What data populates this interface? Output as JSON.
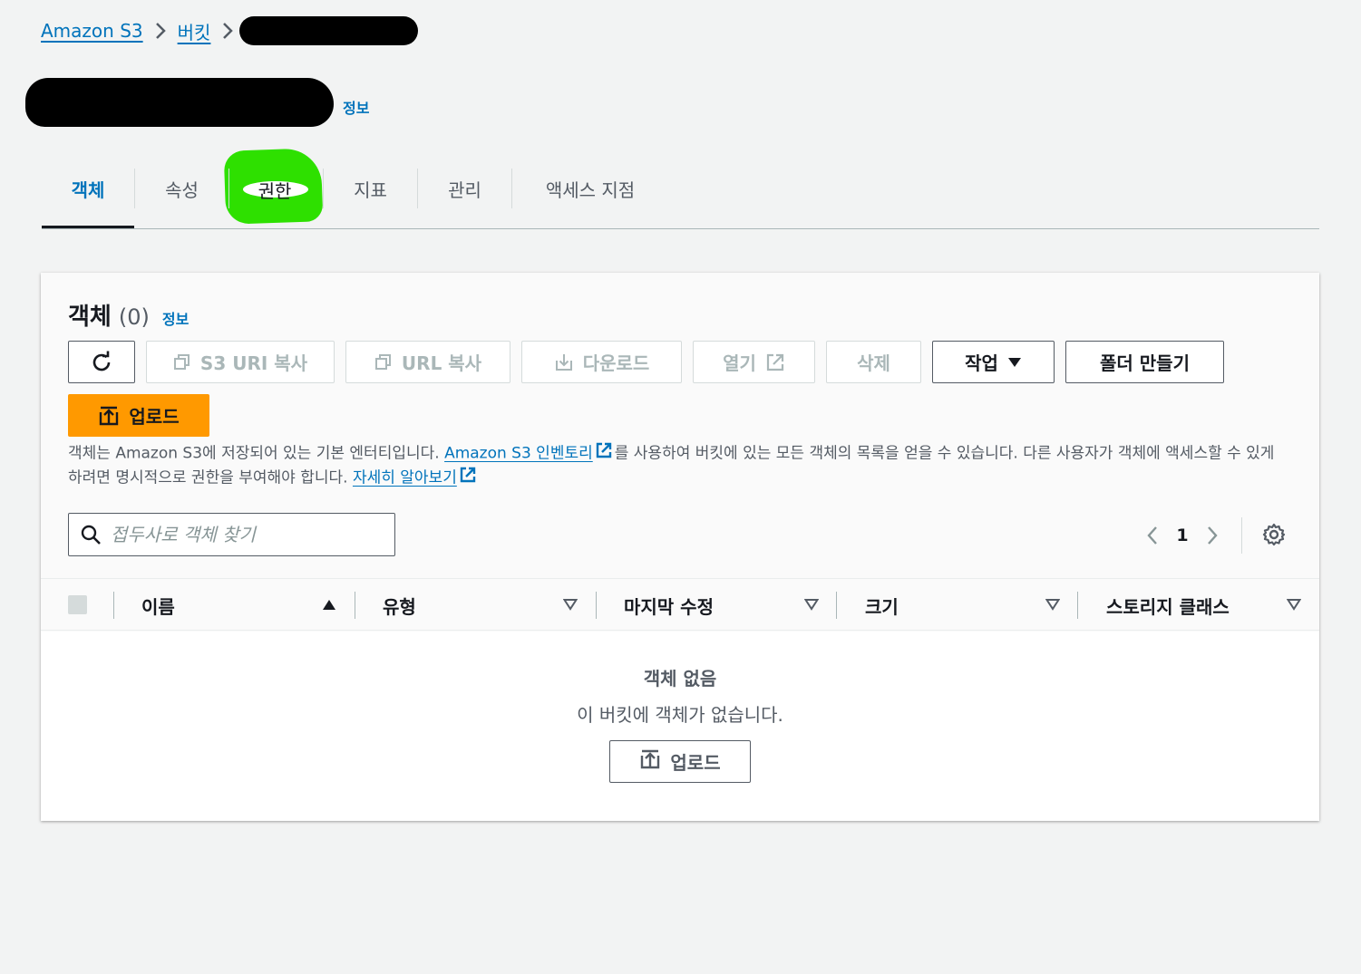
{
  "breadcrumb": {
    "items": [
      {
        "label": "Amazon S3"
      },
      {
        "label": "버킷"
      }
    ]
  },
  "header": {
    "info_label": "정보"
  },
  "tabs": [
    {
      "label": "객체",
      "active": true
    },
    {
      "label": "속성"
    },
    {
      "label": "권한"
    },
    {
      "label": "지표"
    },
    {
      "label": "관리"
    },
    {
      "label": "액세스 지점"
    }
  ],
  "objects_panel": {
    "title": "객체",
    "count": "(0)",
    "info_label": "정보",
    "buttons": {
      "refresh": "",
      "copy_s3_uri": "S3 URI 복사",
      "copy_url": "URL 복사",
      "download": "다운로드",
      "open": "열기",
      "delete": "삭제",
      "actions": "작업",
      "create_folder": "폴더 만들기",
      "upload": "업로드"
    },
    "description": {
      "part1": "객체는 Amazon S3에 저장되어 있는 기본 엔터티입니다. ",
      "link1": "Amazon S3 인벤토리",
      "part2": "를 사용하여 버킷에 있는 모든 객체의 목록을 얻을 수 있습니다. 다른 사용자가 객체에 액세스할 수 있게 하려면 명시적으로 권한을 부여해야 합니다. ",
      "link2": "자세히 알아보기"
    },
    "search": {
      "placeholder": "접두사로 객체 찾기",
      "value": ""
    },
    "pagination": {
      "current_page": "1"
    },
    "table": {
      "columns": [
        "이름",
        "유형",
        "마지막 수정",
        "크기",
        "스토리지 클래스"
      ],
      "sorted_column": "이름",
      "sort_direction": "ascending"
    },
    "empty_state": {
      "title": "객체 없음",
      "subtitle": "이 버킷에 객체가 없습니다.",
      "upload_label": "업로드"
    }
  },
  "colors": {
    "link": "#0073bb",
    "primary_button": "#ff9900",
    "highlight_marker": "#2ee000",
    "redaction": "#000000"
  }
}
